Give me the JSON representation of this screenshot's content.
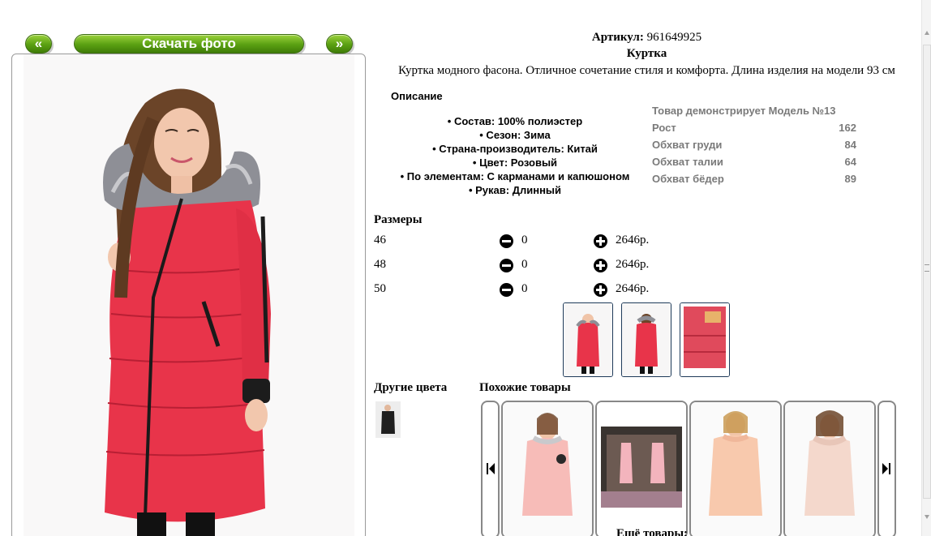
{
  "gallery": {
    "prev_label": "«",
    "download_label": "Скачать фото",
    "next_label": "»"
  },
  "product": {
    "sku_label": "Артикул:",
    "sku_value": "961649925",
    "title": "Куртка",
    "description": "Куртка модного фасона. Отличное сочетание стиля и комфорта. Длина изделия на модели 93 см",
    "description_heading": "Описание",
    "specs": [
      "• Состав: 100% полиэстер",
      "• Сезон: Зима",
      "• Страна-производитель: Китай",
      "• Цвет: Розовый",
      "• По элементам: С карманами и капюшоном",
      "• Рукав: Длинный"
    ]
  },
  "model": {
    "heading": "Товар демонстрирует Модель №13",
    "rows": [
      {
        "label": "Рост",
        "value": "162"
      },
      {
        "label": "Обхват груди",
        "value": "84"
      },
      {
        "label": "Обхват талии",
        "value": "64"
      },
      {
        "label": "Обхват бёдер",
        "value": "89"
      }
    ]
  },
  "sizes": {
    "heading": "Размеры",
    "rows": [
      {
        "size": "46",
        "qty": "0",
        "price": "2646р."
      },
      {
        "size": "48",
        "qty": "0",
        "price": "2646р."
      },
      {
        "size": "50",
        "qty": "0",
        "price": "2646р."
      }
    ]
  },
  "sections": {
    "other_colors": "Другие цвета",
    "similar": "Похожие товары",
    "more": "Ещё товары:"
  },
  "colors": {
    "accent_green": "#5aa012",
    "jacket_red": "#e8344a",
    "frame_navy": "#1f3b5a"
  }
}
